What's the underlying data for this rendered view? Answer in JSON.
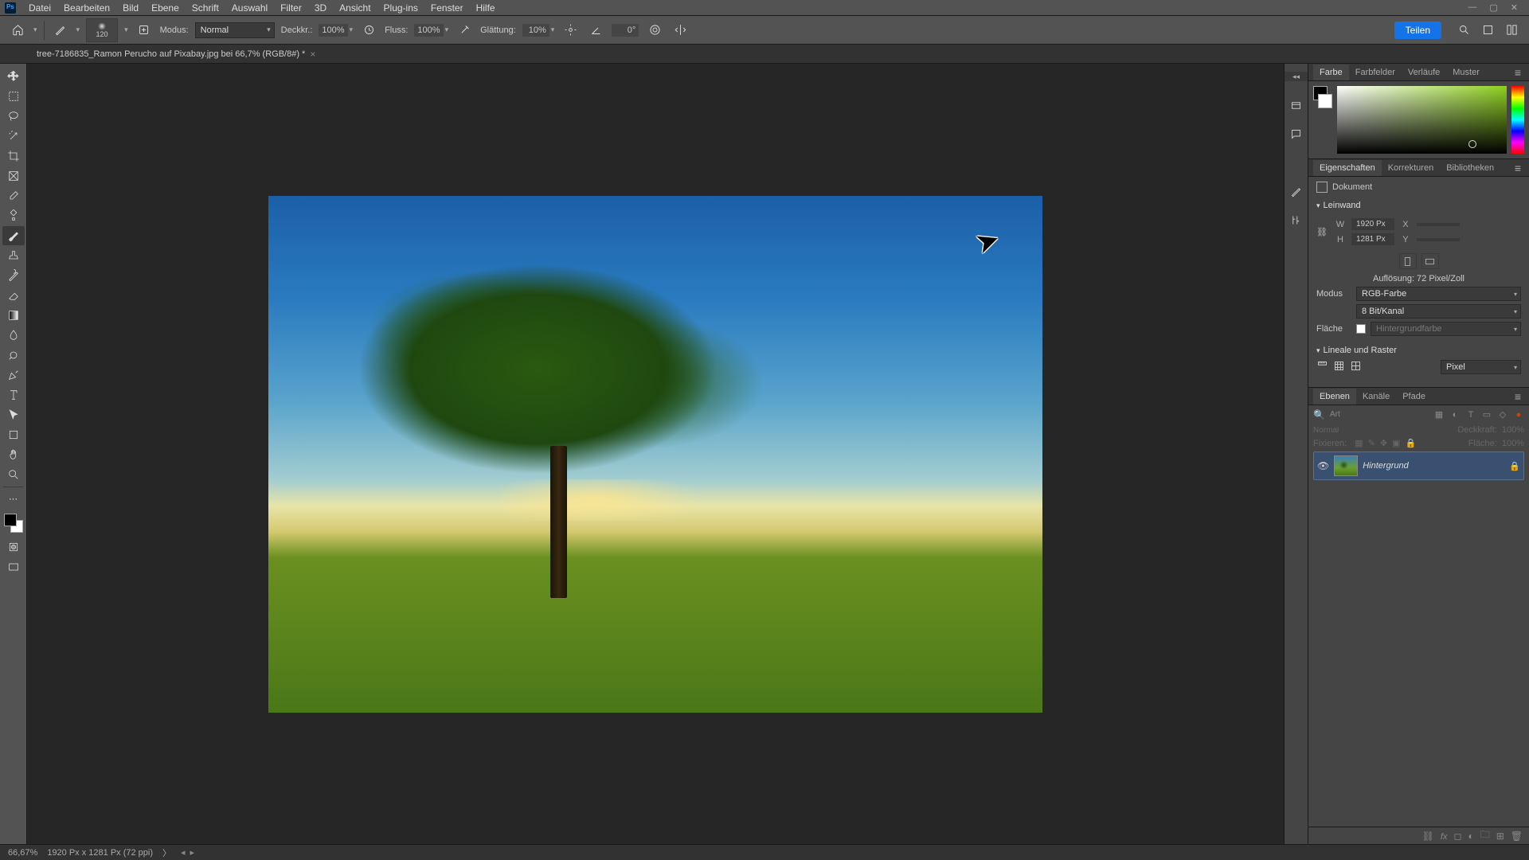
{
  "menu": {
    "items": [
      "Datei",
      "Bearbeiten",
      "Bild",
      "Ebene",
      "Schrift",
      "Auswahl",
      "Filter",
      "3D",
      "Ansicht",
      "Plug-ins",
      "Fenster",
      "Hilfe"
    ]
  },
  "options": {
    "brush_size": "120",
    "mode_label": "Modus:",
    "mode_value": "Normal",
    "opacity_label": "Deckkr.:",
    "opacity_value": "100%",
    "flow_label": "Fluss:",
    "flow_value": "100%",
    "smoothing_label": "Glättung:",
    "smoothing_value": "10%",
    "angle_value": "0°",
    "share_label": "Teilen"
  },
  "document": {
    "tab_title": "tree-7186835_Ramon Perucho auf Pixabay.jpg bei 66,7% (RGB/8#) *"
  },
  "panels": {
    "color": {
      "tabs": [
        "Farbe",
        "Farbfelder",
        "Verläufe",
        "Muster"
      ]
    },
    "properties": {
      "tabs": [
        "Eigenschaften",
        "Korrekturen",
        "Bibliotheken"
      ],
      "doc_label": "Dokument",
      "canvas_section": "Leinwand",
      "width_label": "W",
      "width_value": "1920 Px",
      "x_label": "X",
      "height_label": "H",
      "height_value": "1281 Px",
      "y_label": "Y",
      "resolution_label": "Auflösung: 72 Pixel/Zoll",
      "mode_label": "Modus",
      "mode_value": "RGB-Farbe",
      "depth_value": "8 Bit/Kanal",
      "fill_label": "Fläche",
      "fill_value": "Hintergrundfarbe",
      "rulers_section": "Lineale und Raster",
      "unit_value": "Pixel"
    },
    "layers": {
      "tabs": [
        "Ebenen",
        "Kanäle",
        "Pfade"
      ],
      "kind_placeholder": "Art",
      "blend_mode": "Normal",
      "opacity_label": "Deckkraft:",
      "opacity_value": "100%",
      "lock_label": "Fixieren:",
      "fill_label": "Fläche:",
      "fill_value": "100%",
      "layer_name": "Hintergrund"
    }
  },
  "status": {
    "zoom": "66,67%",
    "doc_info": "1920 Px x 1281 Px (72 ppi)"
  }
}
